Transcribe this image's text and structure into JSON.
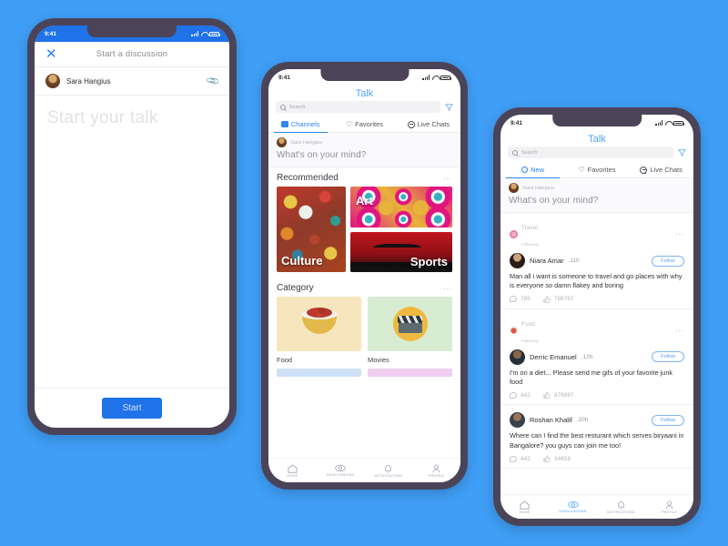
{
  "canvas": {
    "background": "#3f9ef5"
  },
  "phone1": {
    "status": {
      "time": "9:41"
    },
    "topbar": {
      "close_icon": "close-icon",
      "title": "Start a discussion"
    },
    "user": {
      "name": "Sara Hangius",
      "attach_icon": "paperclip-icon"
    },
    "composer": {
      "placeholder": "Start your talk",
      "value": ""
    },
    "footer": {
      "start_label": "Start"
    }
  },
  "phone2": {
    "status": {
      "time": "9:41"
    },
    "app_title": "Talk",
    "search": {
      "placeholder": "Search",
      "icon": "search-icon",
      "filter_icon": "filter-icon"
    },
    "tabs": [
      {
        "label": "Channels",
        "icon": "tv-icon",
        "active": true
      },
      {
        "label": "Favorites",
        "icon": "heart-icon",
        "active": false
      },
      {
        "label": "Live Chats",
        "icon": "chat-icon",
        "active": false
      }
    ],
    "composer": {
      "user": "Sara Hangius",
      "prompt": "What's on your mind?"
    },
    "recommended": {
      "title": "Recommended",
      "more_icon": "more-dots-icon",
      "cards": [
        {
          "label": "Culture"
        },
        {
          "label": "Art"
        },
        {
          "label": "Sports"
        }
      ]
    },
    "category": {
      "title": "Category",
      "more_icon": "more-dots-icon",
      "items": [
        {
          "label": "Food",
          "icon": "food-bowl-icon"
        },
        {
          "label": "Movies",
          "icon": "clapperboard-icon"
        }
      ]
    },
    "bottom_nav": [
      {
        "label": "HOME",
        "icon": "home-icon",
        "active": false
      },
      {
        "label": "DISSCUSSIONS",
        "icon": "eye-icon",
        "active": false
      },
      {
        "label": "NOTIFICATIONS",
        "icon": "bell-icon",
        "active": false
      },
      {
        "label": "PROFILE",
        "icon": "user-icon",
        "active": false
      }
    ]
  },
  "phone3": {
    "status": {
      "time": "9:41"
    },
    "app_title": "Talk",
    "search": {
      "placeholder": "Search",
      "icon": "search-icon",
      "filter_icon": "filter-icon"
    },
    "tabs": [
      {
        "label": "New",
        "icon": "ring-icon",
        "active": true
      },
      {
        "label": "Favorites",
        "icon": "heart-icon",
        "active": false
      },
      {
        "label": "Live Chats",
        "icon": "chat-icon",
        "active": false
      }
    ],
    "composer": {
      "user": "Sara Hangius",
      "prompt": "What's on your mind?"
    },
    "posts": [
      {
        "channel": "Travel",
        "channel_status": "Following",
        "more_icon": "more-dots-icon",
        "author": "Niara Amar",
        "time": ".11h",
        "follow_label": "Follow",
        "body": "Man all i want is someone to travel and go places with why is everyone so damn flakey and boring",
        "comments": "765",
        "likes": "786767"
      },
      {
        "channel": "Food",
        "channel_status": "Following",
        "more_icon": "more-dots-icon",
        "author": "Derric Emanuel",
        "time": ".12h",
        "follow_label": "Follow",
        "body": "I'm on a diet... Please send me gifs of your favorite junk food",
        "comments": "442",
        "likes": "876887"
      },
      {
        "channel": "",
        "channel_status": "",
        "more_icon": "",
        "author": "Roshan Khalif",
        "time": ".20h",
        "follow_label": "Follow",
        "body": "Where can I find the best resturant which serves biryaani in Bangalore? you guys can join me too!",
        "comments": "442",
        "likes": "34658"
      }
    ],
    "bottom_nav": [
      {
        "label": "HOME",
        "icon": "home-icon",
        "active": false
      },
      {
        "label": "DISSCUSSIONS",
        "icon": "eye-icon",
        "active": true
      },
      {
        "label": "NOTIFICATIONS",
        "icon": "bell-icon",
        "active": false
      },
      {
        "label": "PROFILE",
        "icon": "user-icon",
        "active": false
      }
    ]
  }
}
